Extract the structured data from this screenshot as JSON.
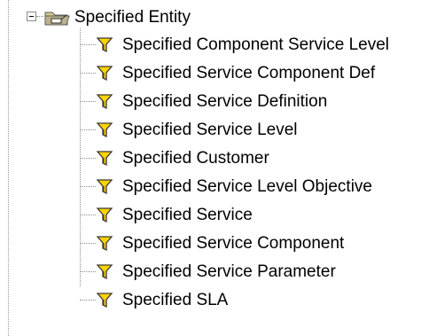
{
  "tree": {
    "root": {
      "label": "Specified Entity",
      "expander": "minus",
      "icon": "folder-icon"
    },
    "children": [
      {
        "label": "Specified Component Service Level",
        "icon": "filter-icon"
      },
      {
        "label": "Specified Service Component Def",
        "icon": "filter-icon"
      },
      {
        "label": "Specified Service Definition",
        "icon": "filter-icon"
      },
      {
        "label": "Specified Service Level",
        "icon": "filter-icon"
      },
      {
        "label": "Specified Customer",
        "icon": "filter-icon"
      },
      {
        "label": "Specified Service Level Objective",
        "icon": "filter-icon"
      },
      {
        "label": "Specified Service",
        "icon": "filter-icon"
      },
      {
        "label": "Specified Service Component",
        "icon": "filter-icon"
      },
      {
        "label": "Specified Service Parameter",
        "icon": "filter-icon"
      },
      {
        "label": "Specified SLA",
        "icon": "filter-icon"
      }
    ]
  },
  "colors": {
    "connector": "#8c8c8c",
    "filter_fill": "#ffd400",
    "filter_outline": "#3a3a3a",
    "folder_fill": "#d7c68a"
  }
}
